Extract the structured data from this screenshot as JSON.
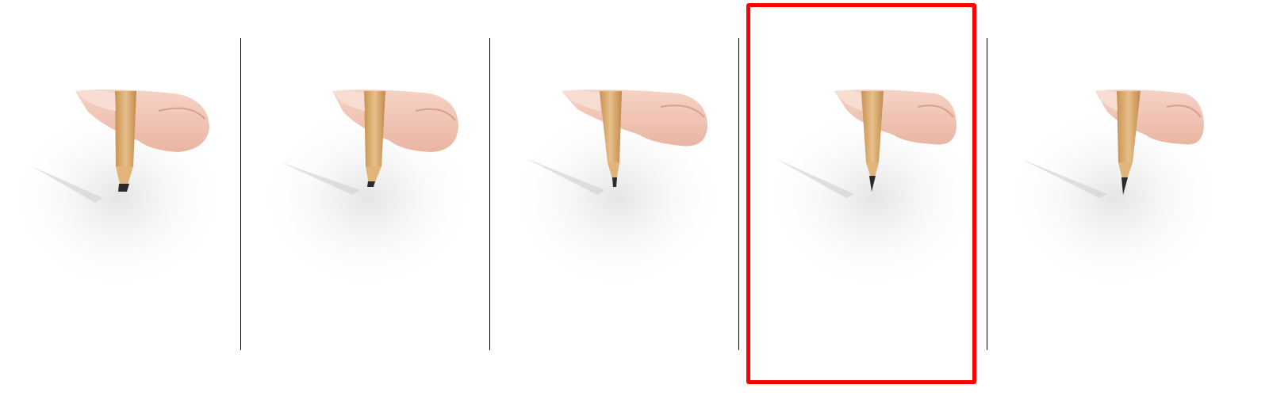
{
  "gallery": {
    "panel_count": 5,
    "selected_index": 3,
    "colors": {
      "background": "#ffffff",
      "divider": "#000000",
      "selection": "#ff0000",
      "pencil_wood": "#d6a86a",
      "pencil_lead": "#2b2b2b",
      "skin": "#f2c4b4"
    },
    "panels": [
      {
        "id": "sharpness-1",
        "lead_state": "blunt",
        "icon": "pencil-icon"
      },
      {
        "id": "sharpness-2",
        "lead_state": "slightly-blunt",
        "icon": "pencil-icon"
      },
      {
        "id": "sharpness-3",
        "lead_state": "medium",
        "icon": "pencil-icon"
      },
      {
        "id": "sharpness-4",
        "lead_state": "sharp",
        "icon": "pencil-icon"
      },
      {
        "id": "sharpness-5",
        "lead_state": "very-sharp",
        "icon": "pencil-icon"
      }
    ]
  }
}
